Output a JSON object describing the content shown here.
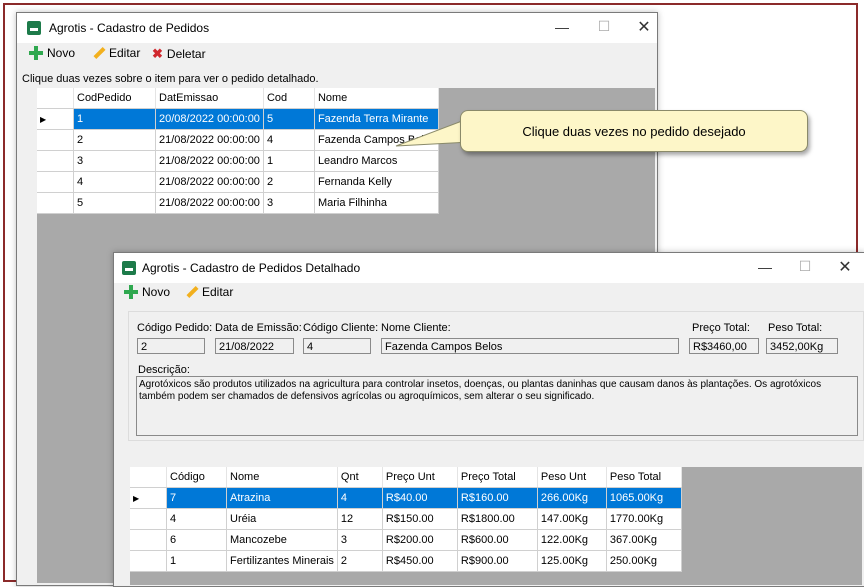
{
  "win1": {
    "title": "Agrotis - Cadastro de Pedidos",
    "btn_novo": "Novo",
    "btn_editar": "Editar",
    "btn_deletar": "Deletar",
    "hint": "Clique duas vezes sobre o item para ver o pedido detalhado.",
    "columns": [
      "CodPedido",
      "DatEmissao",
      "Cod",
      "Nome"
    ],
    "rows": [
      [
        "1",
        "20/08/2022 00:00:00",
        "5",
        "Fazenda Terra Mirante"
      ],
      [
        "2",
        "21/08/2022 00:00:00",
        "4",
        "Fazenda Campos Belos"
      ],
      [
        "3",
        "21/08/2022 00:00:00",
        "1",
        "Leandro Marcos"
      ],
      [
        "4",
        "21/08/2022 00:00:00",
        "2",
        "Fernanda Kelly"
      ],
      [
        "5",
        "21/08/2022 00:00:00",
        "3",
        "Maria Filhinha"
      ]
    ]
  },
  "callout": "Clique duas vezes no pedido desejado",
  "win2": {
    "title": "Agrotis - Cadastro de Pedidos Detalhado",
    "btn_novo": "Novo",
    "btn_editar": "Editar",
    "lbl_codigo_pedido": "Código Pedido:",
    "lbl_data_emissao": "Data de Emissão:",
    "lbl_codigo_cliente": "Código Cliente:",
    "lbl_nome_cliente": "Nome Cliente:",
    "lbl_preco_total": "Preço Total:",
    "lbl_peso_total": "Peso Total:",
    "val_codigo_pedido": "2",
    "val_data_emissao": "21/08/2022",
    "val_codigo_cliente": "4",
    "val_nome_cliente": "Fazenda Campos Belos",
    "val_preco_total": "R$3460,00",
    "val_peso_total": "3452,00Kg",
    "lbl_descricao": "Descrição:",
    "descricao_1": "Agrotóxicos são produtos utilizados na agricultura para controlar insetos, doenças, ou plantas daninhas que causam danos às plantações. Os agrotóxicos",
    "descricao_2": "também podem ser chamados de defensivos agrícolas ou agroquímicos, sem alterar o seu significado.",
    "columns": [
      "Código",
      "Nome",
      "Qnt",
      "Preço Unt",
      "Preço Total",
      "Peso Unt",
      "Peso Total"
    ],
    "rows": [
      [
        "7",
        "Atrazina",
        "4",
        "R$40.00",
        "R$160.00",
        "266.00Kg",
        "1065.00Kg"
      ],
      [
        "4",
        "Uréia",
        "12",
        "R$150.00",
        "R$1800.00",
        "147.00Kg",
        "1770.00Kg"
      ],
      [
        "6",
        "Mancozebe",
        "3",
        "R$200.00",
        "R$600.00",
        "122.00Kg",
        "367.00Kg"
      ],
      [
        "1",
        "Fertilizantes Minerais",
        "2",
        "R$450.00",
        "R$900.00",
        "125.00Kg",
        "250.00Kg"
      ]
    ]
  },
  "colors": {
    "selection": "#0078d7",
    "callout_bg": "#fdf6c8",
    "frame": "#8b2a2a"
  }
}
